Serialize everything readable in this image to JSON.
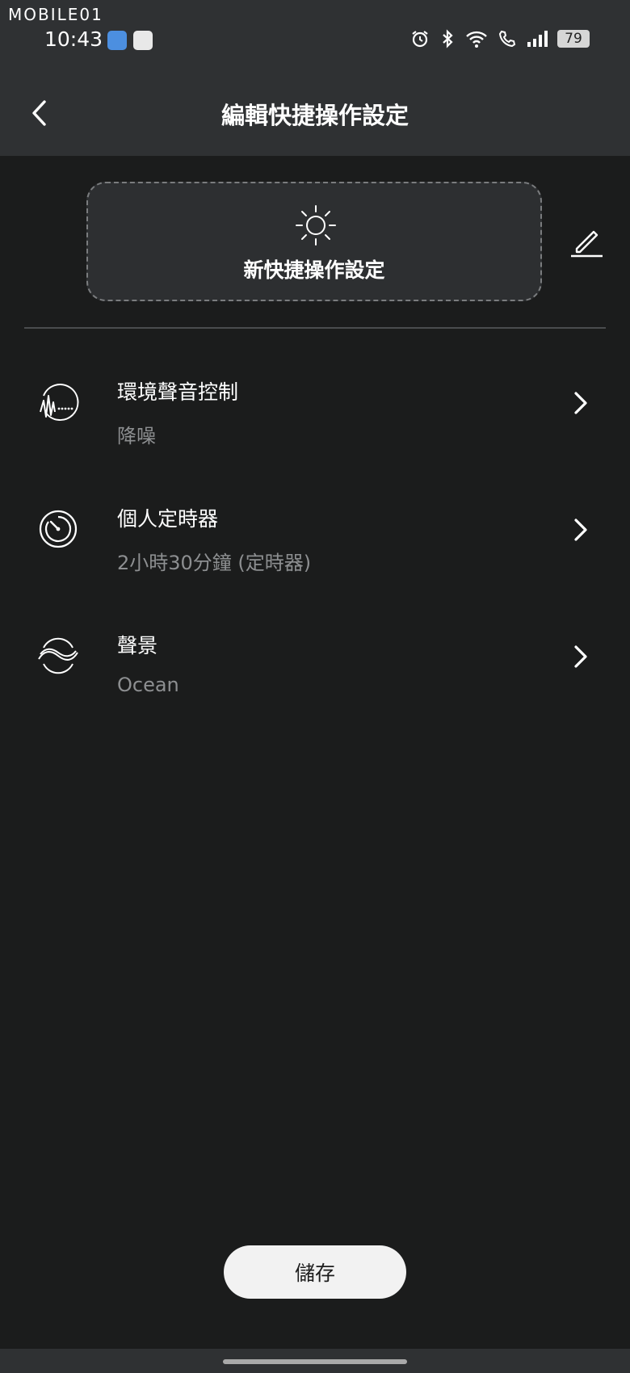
{
  "watermark": "MOBILE01",
  "status_bar": {
    "time": "10:43",
    "battery": "79"
  },
  "header": {
    "title": "編輯快捷操作設定"
  },
  "preset": {
    "name": "新快捷操作設定"
  },
  "settings": [
    {
      "label": "環境聲音控制",
      "value": "降噪",
      "icon": "ambient-sound-icon"
    },
    {
      "label": "個人定時器",
      "value": "2小時30分鐘 (定時器)",
      "icon": "timer-icon"
    },
    {
      "label": "聲景",
      "value": "Ocean",
      "icon": "soundscape-icon"
    }
  ],
  "footer": {
    "save_label": "儲存"
  },
  "colors": {
    "background": "#1b1c1c",
    "header": "#2f3133",
    "secondary_text": "#8d8f91",
    "button": "#f2f2f2"
  }
}
